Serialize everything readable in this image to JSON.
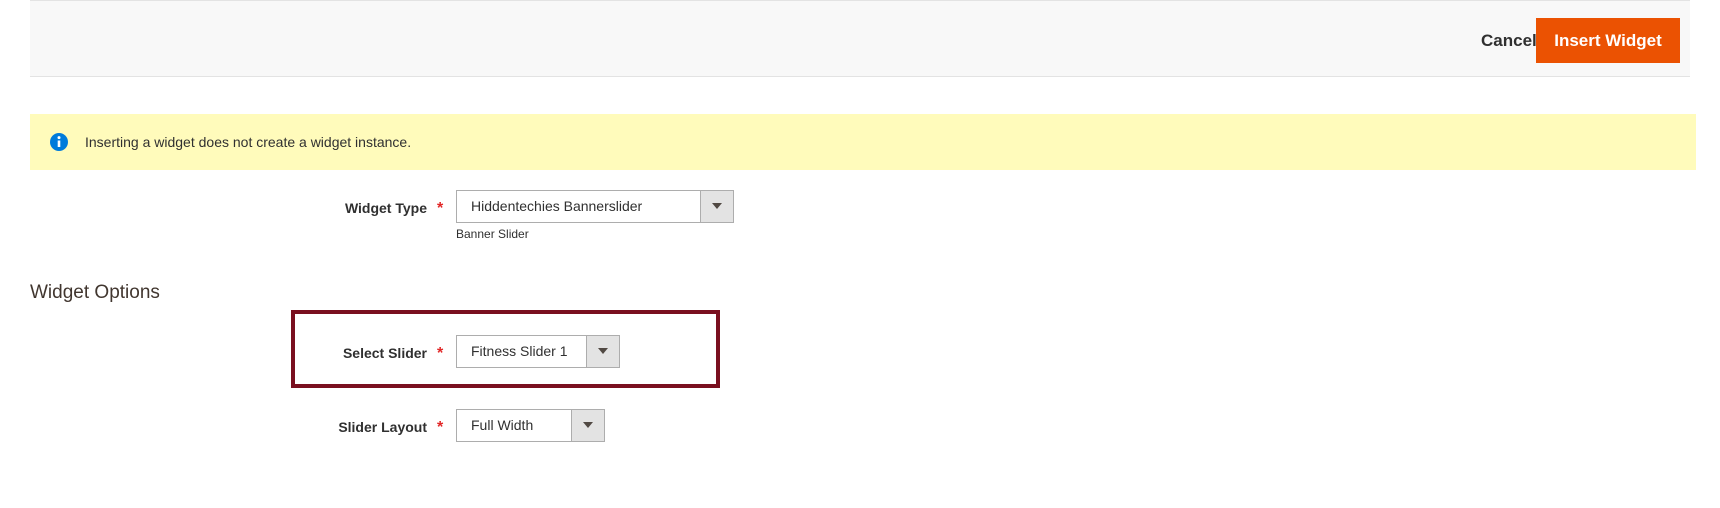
{
  "toolbar": {
    "cancel_label": "Cancel",
    "insert_label": "Insert Widget"
  },
  "notice": {
    "icon": "info-icon",
    "text": "Inserting a widget does not create a widget instance."
  },
  "widget_type": {
    "label": "Widget Type",
    "required_mark": "*",
    "value": "Hiddentechies Bannerslider",
    "note": "Banner Slider"
  },
  "widget_options": {
    "title": "Widget Options",
    "select_slider": {
      "label": "Select Slider",
      "required_mark": "*",
      "value": "Fitness Slider 1"
    },
    "slider_layout": {
      "label": "Slider Layout",
      "required_mark": "*",
      "value": "Full Width"
    }
  },
  "colors": {
    "primary_button": "#eb5202",
    "notice_background": "#fffbbb",
    "highlight_border": "#7a0f1f",
    "required": "#e22626",
    "info_icon": "#007bdb"
  }
}
